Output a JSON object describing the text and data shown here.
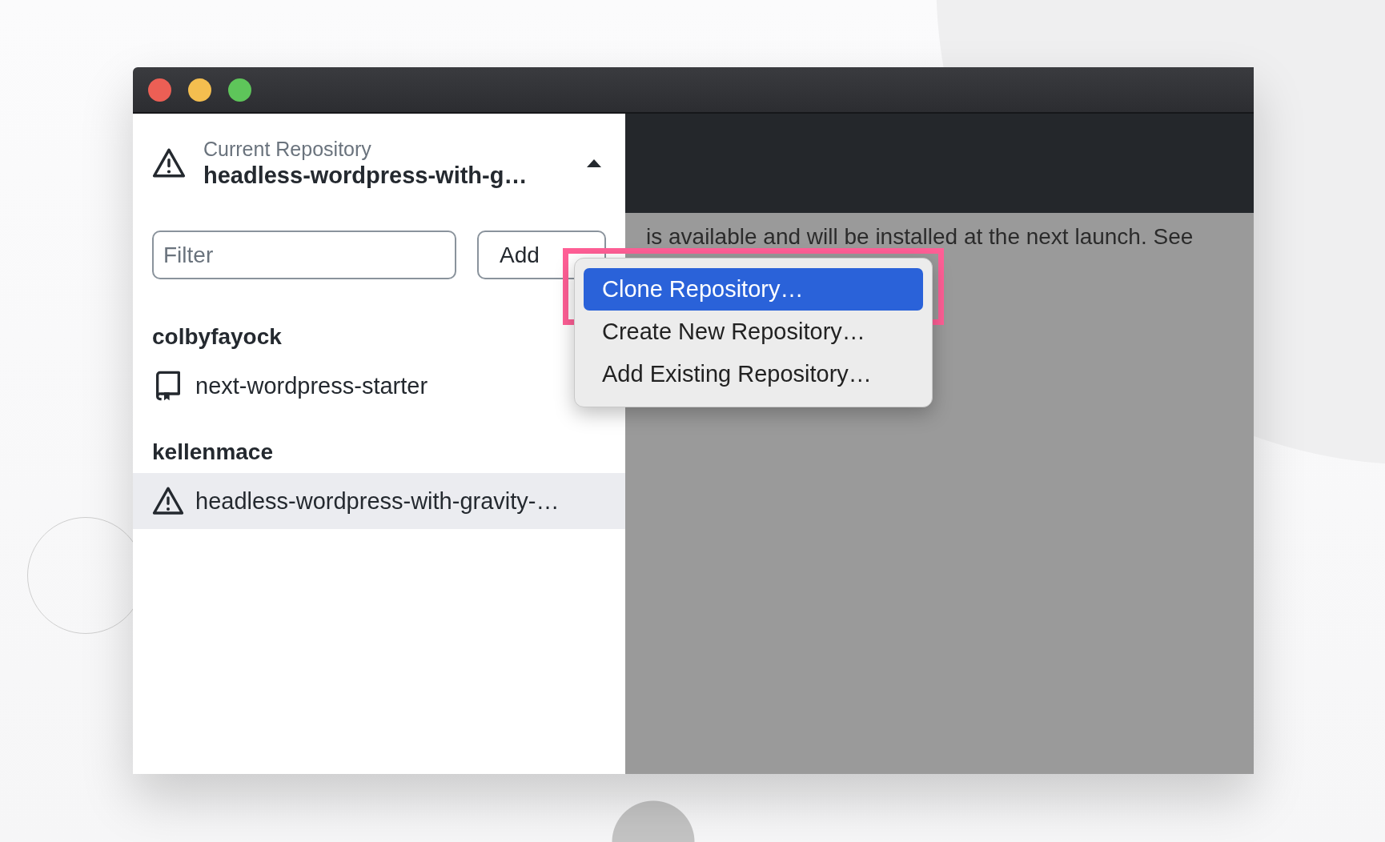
{
  "sidebar": {
    "current_repository": {
      "label": "Current Repository",
      "name": "headless-wordpress-with-g…",
      "expanded": true
    },
    "filter": {
      "placeholder": "Filter"
    },
    "add_button": {
      "label": "Add"
    },
    "groups": [
      {
        "owner": "colbyfayock",
        "repos": [
          {
            "name": "next-wordpress-starter",
            "kind": "repo",
            "selected": false
          }
        ]
      },
      {
        "owner": "kellenmace",
        "repos": [
          {
            "name": "headless-wordpress-with-gravity-…",
            "kind": "warning",
            "selected": true
          }
        ]
      }
    ]
  },
  "banner": {
    "text": "is available and will be installed at the next launch. See"
  },
  "add_menu": {
    "items": [
      {
        "label": "Clone Repository…",
        "selected": true
      },
      {
        "label": "Create New Repository…",
        "selected": false
      },
      {
        "label": "Add Existing Repository…",
        "selected": false
      }
    ]
  }
}
